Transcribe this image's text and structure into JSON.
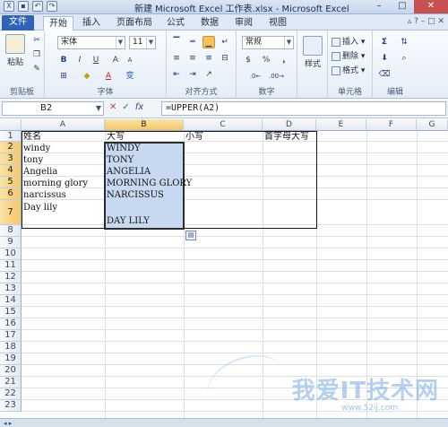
{
  "window": {
    "title": "新建 Microsoft Excel 工作表.xlsx - Microsoft Excel",
    "controls": [
      "–",
      "□",
      "✕"
    ]
  },
  "tabs": [
    {
      "label": "文件",
      "active": false,
      "file": true
    },
    {
      "label": "开始",
      "active": true
    },
    {
      "label": "插入"
    },
    {
      "label": "页面布局"
    },
    {
      "label": "公式"
    },
    {
      "label": "数据"
    },
    {
      "label": "审阅"
    },
    {
      "label": "视图"
    }
  ],
  "ribbon": {
    "clipboard": {
      "label": "剪贴板",
      "paste": "粘贴"
    },
    "font": {
      "label": "字体",
      "name": "宋体",
      "size": "11",
      "bold": "B",
      "italic": "I",
      "underline": "U",
      "grow": "A",
      "shrink": "A",
      "color": "A",
      "wen": "变"
    },
    "alignment": {
      "label": "对齐方式"
    },
    "number": {
      "label": "数字",
      "format": "常规",
      "percent": "%",
      "comma": ",",
      "currency": "$"
    },
    "styles": {
      "label": "样式",
      "button": "样式"
    },
    "cells": {
      "label": "单元格",
      "insert": "插入",
      "delete": "删除",
      "format": "格式"
    },
    "editing": {
      "label": "编辑",
      "sum": "Σ"
    }
  },
  "formula_bar": {
    "name_box": "B2",
    "fx": "fx",
    "formula": "=UPPER(A2)"
  },
  "columns": [
    "A",
    "B",
    "C",
    "D",
    "E",
    "F",
    "G"
  ],
  "rows": [
    "1",
    "2",
    "3",
    "4",
    "5",
    "6",
    "7",
    "8",
    "9",
    "10",
    "11",
    "12",
    "13",
    "14",
    "15",
    "16",
    "17",
    "18",
    "19",
    "20",
    "21",
    "22",
    "23"
  ],
  "cells": {
    "A1": "姓名",
    "B1": "大写",
    "C1": "小写",
    "D1": "首字母大写",
    "A2": "windy",
    "B2": "WINDY",
    "A3": "tony",
    "B3": "TONY",
    "A4": "Angelia",
    "B4": "ANGELIA",
    "A5": "morning glory",
    "B5": "MORNING GLORY",
    "A6": "narcissus",
    "B6": "NARCISSUS",
    "A7": "Day lily",
    "B7": "DAY LILY"
  },
  "watermark": {
    "text": "我爱IT技术网",
    "sub": "www.52ij.com"
  },
  "colors": {
    "file_tab": "#2e63b8",
    "selection_fill": "#c6d9f1",
    "header_selected": "#f2c76a"
  }
}
